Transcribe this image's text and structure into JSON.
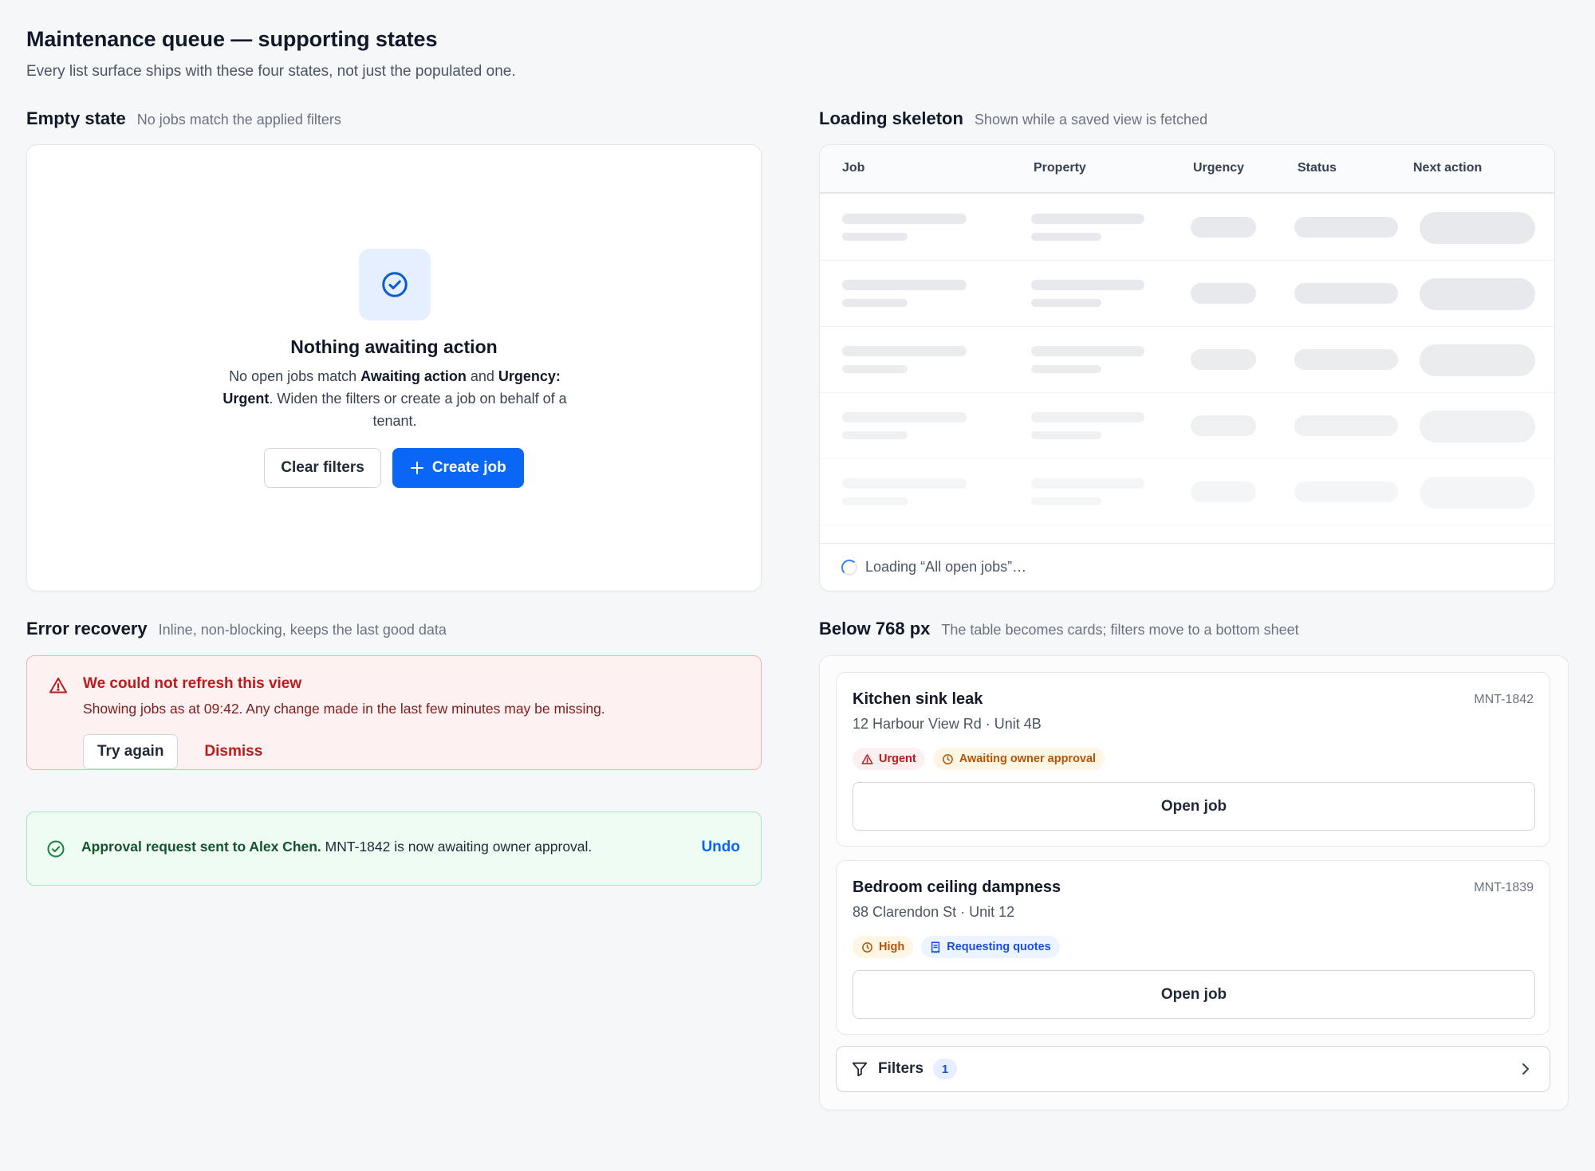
{
  "page": {
    "title": "Maintenance queue — supporting states",
    "subtitle": "Every list surface ships with these four states, not just the populated one."
  },
  "empty_state": {
    "section_title": "Empty state",
    "section_desc": "No jobs match the applied filters",
    "icon": "check-circle-icon",
    "title": "Nothing awaiting action",
    "text_1": "No open jobs match ",
    "filter_1": "Awaiting action",
    "text_2": " and ",
    "filter_2": "Urgency: Urgent",
    "text_3": ". Widen the filters or create a job on behalf of a tenant.",
    "clear_label": "Clear filters",
    "create_label": "Create job"
  },
  "loading": {
    "section_title": "Loading skeleton",
    "section_desc": "Shown while a saved view is fetched",
    "columns": [
      "Job",
      "Property",
      "Urgency",
      "Status",
      "Next action"
    ],
    "footer": "Loading “All open jobs”…"
  },
  "error": {
    "section_title": "Error recovery",
    "section_desc": "Inline, non-blocking, keeps the last good data",
    "title": "We could not refresh this view",
    "text": "Showing jobs as at 09:42. Any change made in the last few minutes may be missing.",
    "retry_label": "Try again",
    "dismiss_label": "Dismiss",
    "icon": "warning-triangle-icon"
  },
  "success": {
    "strong": "Approval request sent to Alex Chen.",
    "text": " MNT-1842 is now awaiting owner approval.",
    "undo_label": "Undo",
    "icon": "check-circle-icon"
  },
  "mobile": {
    "section_title": "Below 768 px",
    "section_desc": "The table becomes cards; filters move to a bottom sheet",
    "jobs": [
      {
        "title": "Kitchen sink leak",
        "id": "MNT-1842",
        "address": "12 Harbour View Rd · Unit 4B",
        "urgency": "Urgent",
        "status": "Awaiting owner approval",
        "open_label": "Open job"
      },
      {
        "title": "Bedroom ceiling dampness",
        "id": "MNT-1839",
        "address": "88 Clarendon St · Unit 12",
        "urgency": "High",
        "status": "Requesting quotes",
        "open_label": "Open job"
      }
    ],
    "filters_label": "Filters",
    "filters_count": "1"
  },
  "colors": {
    "primary": "#0a66f5",
    "error": "#b91c1c",
    "success": "#15803d",
    "warning": "#b45309"
  }
}
